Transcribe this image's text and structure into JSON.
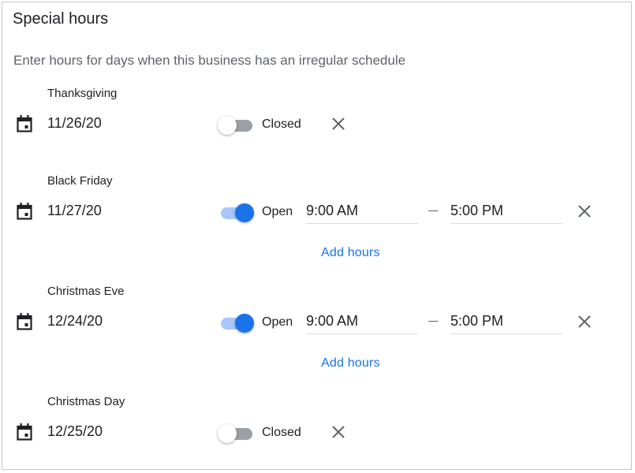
{
  "header": {
    "title": "Special hours",
    "subtitle": "Enter hours for days when this business has an irregular schedule"
  },
  "colors": {
    "accent": "#1a73e8",
    "toggle_off_track": "#9aa0a6",
    "toggle_on_track": "#a8c7fa"
  },
  "days": [
    {
      "name": "Thanksgiving",
      "date": "11/26/20",
      "open": false,
      "status": "Closed"
    },
    {
      "name": "Black Friday",
      "date": "11/27/20",
      "open": true,
      "status": "Open",
      "open_time": "9:00 AM",
      "close_time": "5:00 PM",
      "add_hours_label": "Add hours"
    },
    {
      "name": "Christmas Eve",
      "date": "12/24/20",
      "open": true,
      "status": "Open",
      "open_time": "9:00 AM",
      "close_time": "5:00 PM",
      "add_hours_label": "Add hours"
    },
    {
      "name": "Christmas Day",
      "date": "12/25/20",
      "open": false,
      "status": "Closed"
    }
  ],
  "icons": {
    "calendar": "calendar-icon",
    "remove": "close-icon"
  }
}
